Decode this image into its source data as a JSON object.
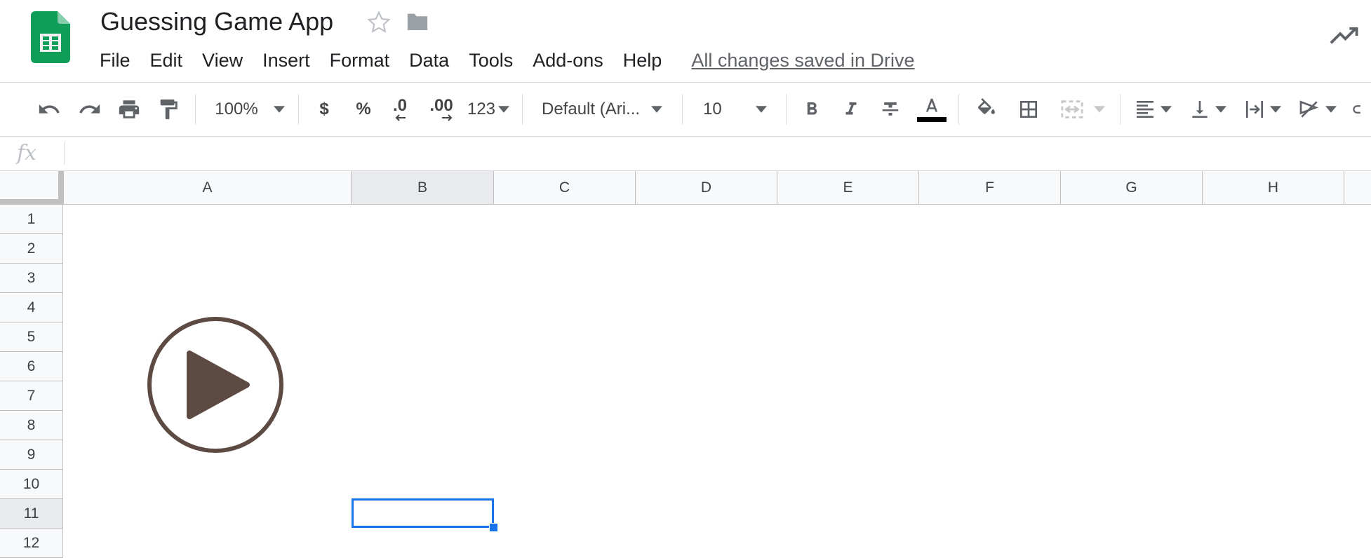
{
  "app": {
    "title": "Guessing Game App",
    "save_status": "All changes saved in Drive",
    "brand_color": "#0f9d58"
  },
  "menu": [
    "File",
    "Edit",
    "View",
    "Insert",
    "Format",
    "Data",
    "Tools",
    "Add-ons",
    "Help"
  ],
  "toolbar": {
    "zoom": "100%",
    "currency_label": "$",
    "percent_label": "%",
    "decrease_decimal_label": ".0",
    "increase_decimal_label": ".00",
    "more_formats_label": "123",
    "font": "Default (Ari...",
    "font_size": "10",
    "text_color": "#000000",
    "icons": [
      "undo-icon",
      "redo-icon",
      "print-icon",
      "paint-format-icon",
      "bold-icon",
      "italic-icon",
      "strikethrough-icon",
      "text-color-icon",
      "fill-color-icon",
      "borders-icon",
      "merge-cells-icon",
      "horizontal-align-icon",
      "vertical-align-icon",
      "text-wrapping-icon",
      "text-rotation-icon"
    ]
  },
  "formula_bar": {
    "label": "fx",
    "value": ""
  },
  "grid": {
    "columns": [
      "A",
      "B",
      "C",
      "D",
      "E",
      "F",
      "G",
      "H"
    ],
    "rows": [
      "1",
      "2",
      "3",
      "4",
      "5",
      "6",
      "7",
      "8",
      "9",
      "10",
      "11",
      "12"
    ],
    "selected_cell": "B11",
    "selection_color": "#1a73e8"
  },
  "drawing": {
    "name": "play-button",
    "color": "#5d4a43"
  }
}
